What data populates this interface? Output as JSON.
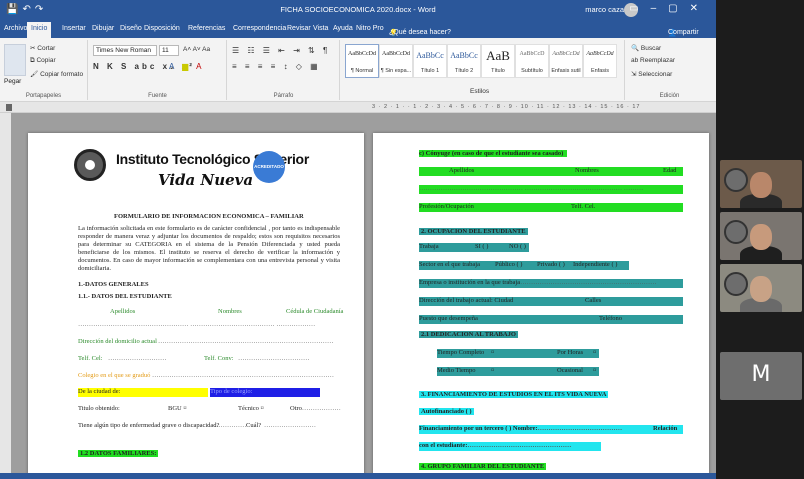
{
  "titlebar": {
    "doc_title": "FICHA SOCIOECONOMICA 2020.docx - Word",
    "user_name": "marco caza",
    "search_hint": "¿Qué desea hacer?",
    "share": "Compartir"
  },
  "tabs": [
    "Archivo",
    "Inicio",
    "Insertar",
    "Dibujar",
    "Diseño",
    "Disposición",
    "Referencias",
    "Correspondencia",
    "Revisar",
    "Vista",
    "Ayuda",
    "Nitro Pro"
  ],
  "ribbon": {
    "clipboard": {
      "paste": "Pegar",
      "cut": "Cortar",
      "copy": "Copiar",
      "format_painter": "Copiar formato",
      "label": "Portapapeles"
    },
    "font": {
      "name": "Times New Roman",
      "size": "11",
      "label": "Fuente"
    },
    "paragraph": {
      "label": "Párrafo"
    },
    "styles": {
      "label": "Estilos",
      "items": [
        {
          "sample": "AaBbCcDd",
          "name": "¶ Normal"
        },
        {
          "sample": "AaBbCcDd",
          "name": "¶ Sin espa..."
        },
        {
          "sample": "AaBbCc",
          "name": "Título 1"
        },
        {
          "sample": "AaBbCc",
          "name": "Título 2"
        },
        {
          "sample": "AaB",
          "name": "Título"
        },
        {
          "sample": "AaBbCcD",
          "name": "Subtítulo"
        },
        {
          "sample": "AaBbCcDd",
          "name": "Énfasis sutil"
        },
        {
          "sample": "AaBbCcDd",
          "name": "Énfasis"
        }
      ]
    },
    "editing": {
      "find": "Buscar",
      "replace": "Reemplazar",
      "select": "Seleccionar",
      "label": "Edición"
    }
  },
  "ruler_numbers": "3 · 2 · 1 · · 1 · 2 · 3 · 4 · 5 · 6 · 7 · 8 · 9 · 10 · 11 · 12 · 13 · 14 · 15 · 16 · 17",
  "page1": {
    "inst_title": "Instituto Tecnológico Superior",
    "inst_sub": "Vida Nueva",
    "seal_text": "ACREDITADO",
    "form_title": "FORMULARIO DE INFORMACION ECONOMICA – FAMILIAR",
    "intro": "La información solicitada en este formulario es de carácter confidencial , por tanto es indispensable responder de manera veraz y adjuntar los documentos de respaldo; estos son requisitos necesarios para determinar su CATEGORIA en el sistema de la Pensión Diferenciada y usted pueda beneficiarse de los mismos. El instituto se reserva el derecho de verificar la información y documentos. En caso de mayor información se complementara con una entrevista personal y visita domiciliaria.",
    "sec1": "1.-DATOS GENERALES",
    "sec11": "1.1.- DATOS  DEL ESTUDIANTE",
    "col_apellidos": "Apellidos",
    "col_nombres": "Nombres",
    "col_cedula": "Cédula de Ciudadanía",
    "direccion": "Dirección del domicilio actual",
    "telf": "Telf.  Cel:",
    "telf_conv": "Telf. Conv:",
    "colegio": "Colegio en el que se graduó",
    "ciudad": "De la ciudad de:",
    "tipo_colegio": "Tipo de colegio:",
    "titulo": "Titulo obtenido:",
    "bgu": "BGU ¤",
    "tecnico": "Técnico ¤",
    "otro": "Otro",
    "enfermedad": "Tiene algún tipo de enfermedad grave o discapacidad?",
    "cual": "Cuál?",
    "sec12": "1.2 DATOS FAMILIARES:"
  },
  "page2": {
    "conyuge": "c) Cónyuge (en caso de que el estudiante sea casado)",
    "apellidos": "Apellidos",
    "nombres": "Nombres",
    "edad": "Edad",
    "profesion": "Profesión/Ocupación",
    "telf_cel": "Telf.  Cel.",
    "sec2": "2.  OCUPACION DEL ESTUDIANTE",
    "trabaja": "Trabaja",
    "si": "SI ( )",
    "no": "NO  ( )",
    "sector": "Sector en el que trabaja",
    "publico": "Público (   )",
    "privado": "Privado (   )",
    "independiente": "Independiente (   )",
    "empresa": "Empresa o institución en la que trabaja",
    "direccion_trabajo": "Dirección del trabajo actual:  Ciudad",
    "calles": "Calles",
    "puesto": "Puesto que desempeña",
    "telefono": "Teléfono",
    "sec21": "2.1 DEDICACION AL TRABAJO",
    "tiempo_completo": "Tiempo Completo",
    "por_horas": "Por Horas",
    "medio_tiempo": "Medio Tiempo",
    "ocasional": "Ocasional",
    "sec3": "3.   FINANCIAMIENTO DE ESTUDIOS EN EL ITS VIDA NUEVA",
    "autofinanciado": "Autofinanciado  (   )",
    "tercero": "Financiamiento por un tercero   (   )  Nombre:",
    "relacion": "Relación",
    "con_estudiante": "con el estudiante:",
    "sec4": "4.  GRUPO FAMILIAR DEL ESTUDIANTE"
  },
  "video_tiles": [
    {
      "name": "participant-1"
    },
    {
      "name": "participant-2"
    },
    {
      "name": "participant-3"
    },
    {
      "letter": "M"
    }
  ],
  "colors": {
    "word_blue": "#2b579a",
    "hl_green": "#22dd22",
    "hl_teal": "#2e9c9c",
    "hl_cyan": "#22e5ee"
  }
}
